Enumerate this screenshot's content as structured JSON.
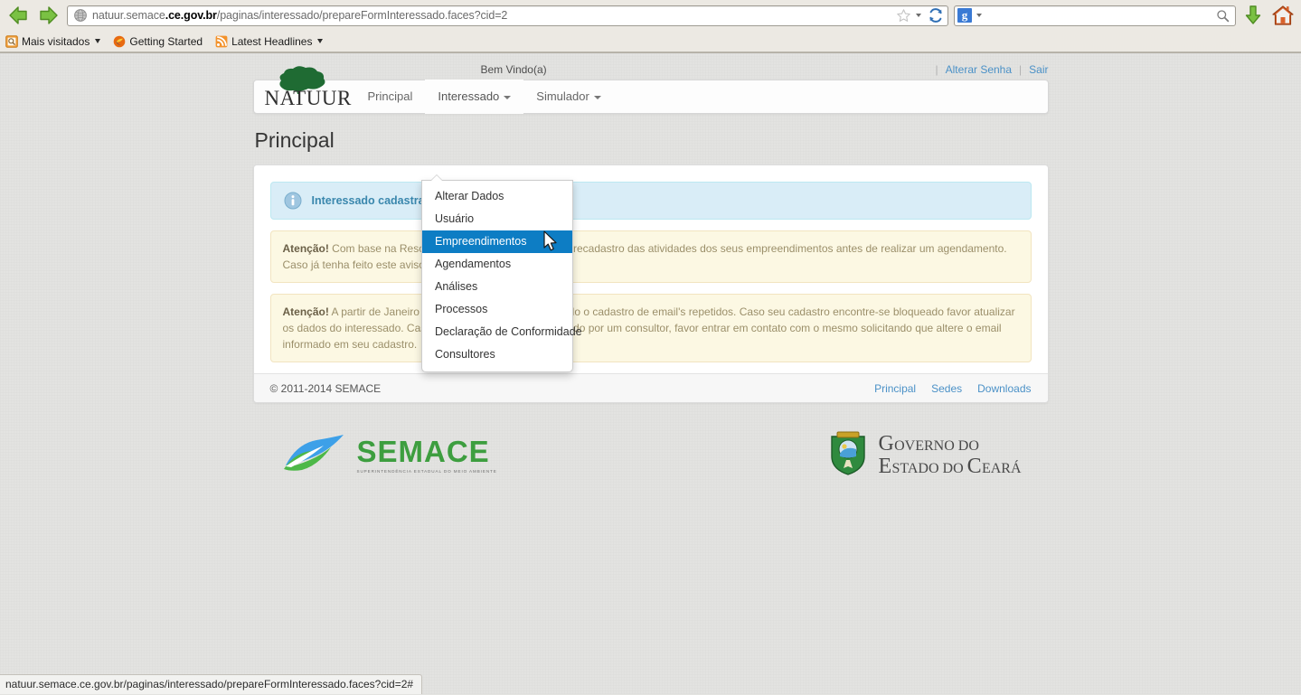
{
  "browser": {
    "back_icon": "back-arrow-icon",
    "forward_icon": "forward-arrow-icon",
    "url_prefix": "natuur.semace",
    "url_host": ".ce.gov.br",
    "url_path": "/paginas/interessado/prepareFormInteressado.faces?cid=2",
    "url_full": "natuur.semace.ce.gov.br/paginas/interessado/prepareFormInteressado.faces?cid=2",
    "search_placeholder": "",
    "search_value": "",
    "search_engine": "g",
    "bookmarks": [
      {
        "label": "Mais visitados",
        "icon": "most-visited-icon",
        "has_caret": true
      },
      {
        "label": "Getting Started",
        "icon": "firefox-icon",
        "has_caret": false
      },
      {
        "label": "Latest Headlines",
        "icon": "rss-feed-icon",
        "has_caret": true
      }
    ]
  },
  "utility": {
    "welcome": "Bem Vindo(a)",
    "separator": "|",
    "change_password": "Alterar Senha",
    "logout": "Sair"
  },
  "navbar": {
    "brand": "NATUUR",
    "brand_icon": "tree-logo-icon",
    "items": [
      {
        "label": "Principal",
        "caret": false
      },
      {
        "label": "Interessado",
        "caret": true
      },
      {
        "label": "Simulador",
        "caret": true
      }
    ]
  },
  "dropdown": {
    "items": [
      {
        "label": "Alterar Dados",
        "active": false
      },
      {
        "label": "Usuário",
        "active": false
      },
      {
        "label": "Empreendimentos",
        "active": true
      },
      {
        "label": "Agendamentos",
        "active": false
      },
      {
        "label": "Análises",
        "active": false
      },
      {
        "label": "Processos",
        "active": false
      },
      {
        "label": "Declaração de Conformidade",
        "active": false
      },
      {
        "label": "Consultores",
        "active": false
      }
    ],
    "highlight_color": "#0d7dc4"
  },
  "page": {
    "title": "Principal",
    "info_alert": {
      "icon": "info-circle-icon",
      "text": "Interessado cadastrado"
    },
    "warning_1": {
      "strong": "Atenção!",
      "text": " Com base na Resolução que precisará ser feito o recadastro das atividades dos seus empreendimentos antes de realizar um agendamento. Caso já tenha feito este aviso."
    },
    "warning_2": {
      "strong": "Atenção!",
      "text": " A partir de Janeiro de 2014 não será mais permitido o cadastro de email's repetidos. Caso seu cadastro encontre-se bloqueado favor atualizar os dados do interessado. Caso seu cadastro seja administrado por um consultor, favor entrar em contato com o mesmo solicitando que altere o email informado em seu cadastro."
    },
    "footer": {
      "copyright": "© 2011-2014 SEMACE",
      "links": [
        "Principal",
        "Sedes",
        "Downloads"
      ]
    }
  },
  "logos": {
    "semace_name": "SEMACE",
    "semace_tagline": "SUPERINTENDÊNCIA ESTADUAL DO MEIO AMBIENTE",
    "gov_line1_big": "G",
    "gov_line1_rest": "OVERNO",
    "gov_line1_small": "DO",
    "gov_line2_big": "E",
    "gov_line2_rest": "STADO",
    "gov_line2_small": "DO",
    "gov_line2_big2": "C",
    "gov_line2_rest2": "EARÁ"
  },
  "status_bar": {
    "text": "natuur.semace.ce.gov.br/paginas/interessado/prepareFormInteressado.faces?cid=2#"
  },
  "colors": {
    "accent_blue": "#4b91c7",
    "highlight": "#0d7dc4",
    "info_bg": "#d9edf7",
    "warn_bg": "#fcf8e3",
    "semace_green": "#3d9e3f"
  }
}
